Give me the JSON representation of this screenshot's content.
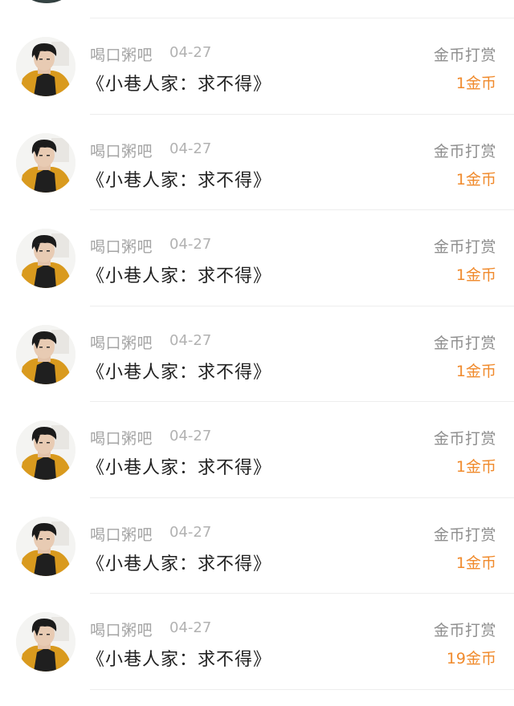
{
  "items": [
    {
      "user": "喝口粥吧",
      "date": "04-27",
      "title": "《小巷人家：求不得》",
      "action": "金币打赏",
      "amount": "1金币"
    },
    {
      "user": "喝口粥吧",
      "date": "04-27",
      "title": "《小巷人家：求不得》",
      "action": "金币打赏",
      "amount": "1金币"
    },
    {
      "user": "喝口粥吧",
      "date": "04-27",
      "title": "《小巷人家：求不得》",
      "action": "金币打赏",
      "amount": "1金币"
    },
    {
      "user": "喝口粥吧",
      "date": "04-27",
      "title": "《小巷人家：求不得》",
      "action": "金币打赏",
      "amount": "1金币"
    },
    {
      "user": "喝口粥吧",
      "date": "04-27",
      "title": "《小巷人家：求不得》",
      "action": "金币打赏",
      "amount": "1金币"
    },
    {
      "user": "喝口粥吧",
      "date": "04-27",
      "title": "《小巷人家：求不得》",
      "action": "金币打赏",
      "amount": "1金币"
    },
    {
      "user": "喝口粥吧",
      "date": "04-27",
      "title": "《小巷人家：求不得》",
      "action": "金币打赏",
      "amount": "19金币"
    }
  ],
  "colors": {
    "amount": "#f08a2c",
    "meta": "#a4a4a4",
    "title": "#222222",
    "divider": "#ededed"
  },
  "icons": {
    "avatar": "user-avatar-photo"
  }
}
